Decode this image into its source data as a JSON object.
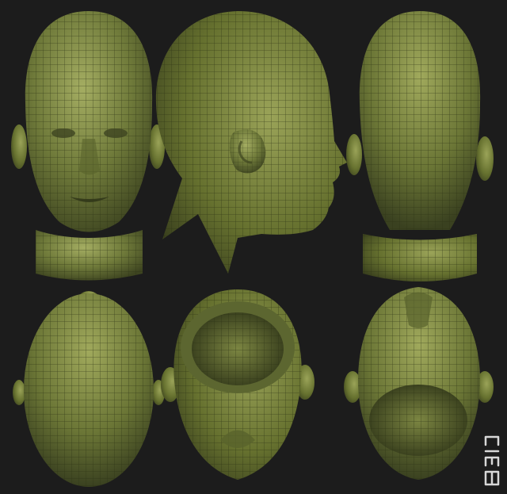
{
  "scene": {
    "background": "#1c1c1c",
    "mesh_color": "#6f7a3a",
    "mesh_highlight": "#a4ad62",
    "mesh_shadow": "#3d4420",
    "wire_color": "#2a3012",
    "views": [
      {
        "id": "front"
      },
      {
        "id": "side"
      },
      {
        "id": "back"
      },
      {
        "id": "top"
      },
      {
        "id": "bottom-neck-opening"
      },
      {
        "id": "bottom-upside-down"
      }
    ]
  },
  "watermark": {
    "text": "CIEB"
  }
}
